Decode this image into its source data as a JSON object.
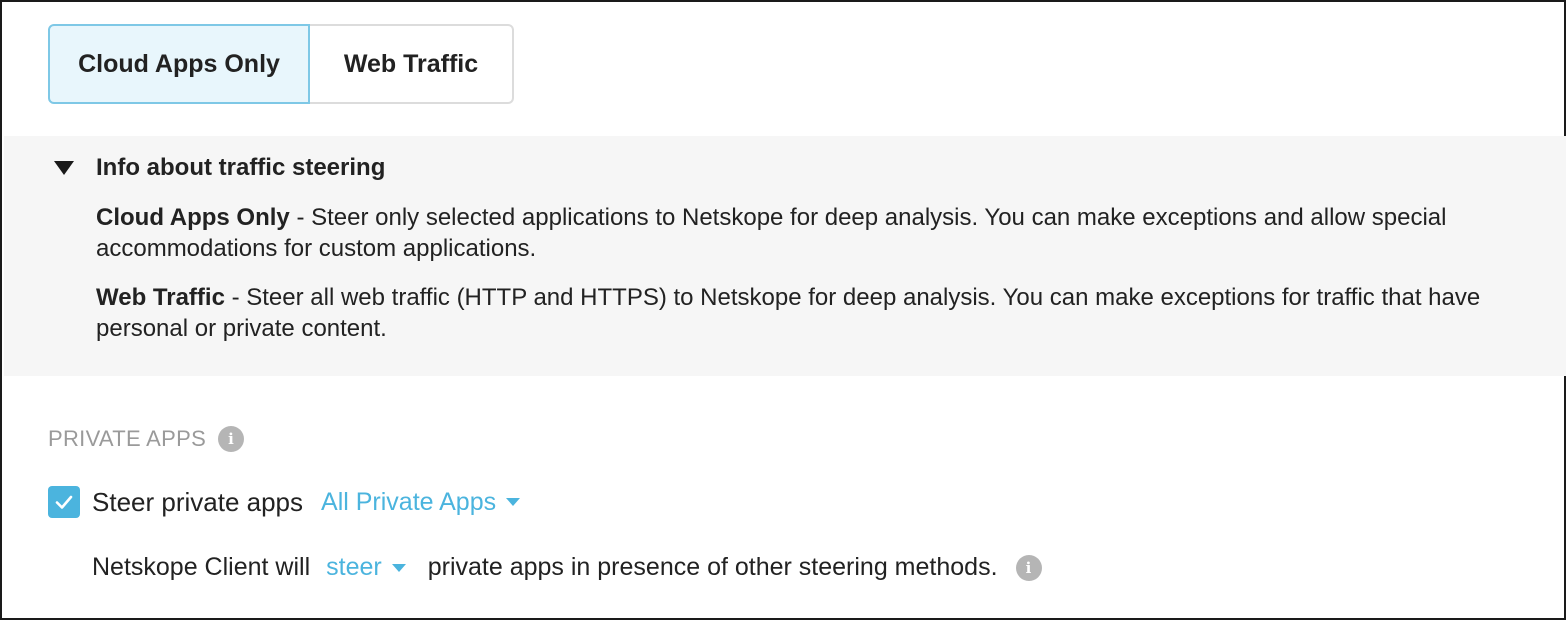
{
  "mode_tabs": {
    "cloud_apps_only": "Cloud Apps Only",
    "web_traffic": "Web Traffic",
    "selected": "cloud_apps_only"
  },
  "info_panel": {
    "title": "Info about traffic steering",
    "expanded": true,
    "cloud_apps": {
      "term": "Cloud Apps Only",
      "text": " - Steer only selected applications to Netskope for deep analysis. You can make exceptions and allow special accommodations for custom applications."
    },
    "web_traffic": {
      "term": "Web Traffic",
      "text": " - Steer all web traffic (HTTP and HTTPS) to Netskope for deep analysis. You can make exceptions for traffic that have personal or private content."
    }
  },
  "private_apps": {
    "section_label": "PRIVATE APPS",
    "steer_checkbox_label": "Steer private apps",
    "steer_checked": true,
    "apps_dropdown_value": "All Private Apps",
    "sentence_prefix": "Netskope Client will",
    "action_dropdown_value": "steer",
    "sentence_suffix": "private apps in presence of other steering methods."
  },
  "icons": {
    "info": "info-icon",
    "check": "checkmark-icon",
    "expand": "triangle-down-icon",
    "caret": "caret-down-icon"
  },
  "colors": {
    "accent": "#4bb4de",
    "selected_tab_bg": "#e8f6fc",
    "selected_tab_border": "#7ec8e6",
    "panel_bg": "#f6f6f6",
    "muted_label": "#9a9a9a"
  }
}
